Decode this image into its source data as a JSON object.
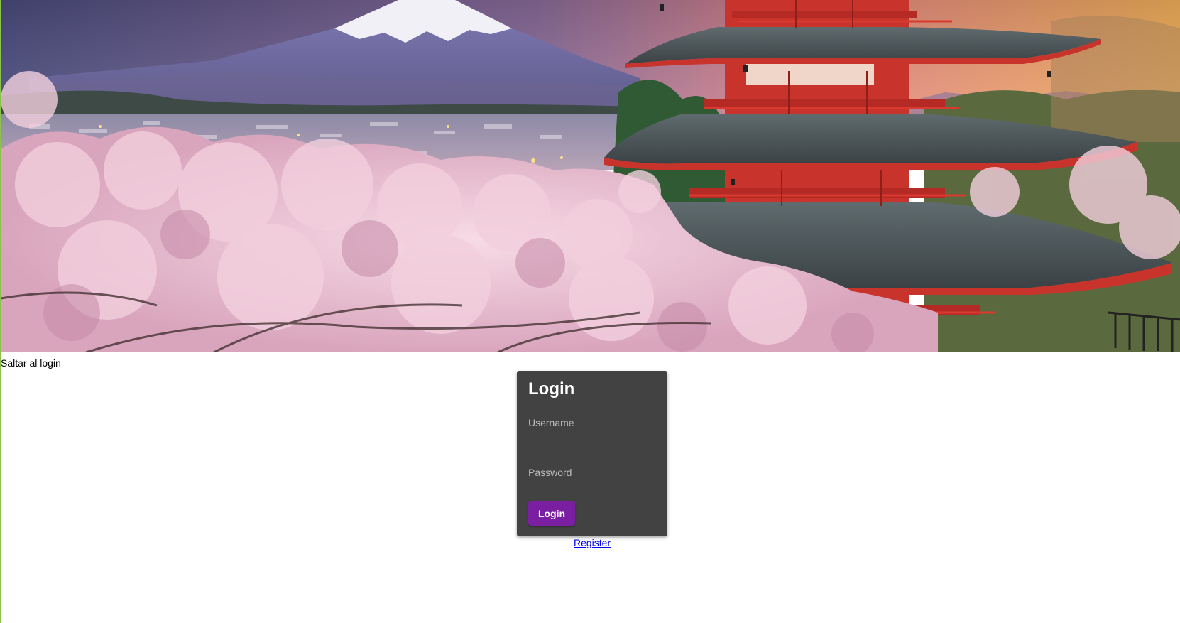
{
  "hero": {
    "image_alt": "Mount Fuji with cherry blossoms and red pagoda"
  },
  "skip_link": {
    "label": "Saltar al login"
  },
  "login": {
    "title": "Login",
    "username_placeholder": "Username",
    "password_placeholder": "Password",
    "button_label": "Login"
  },
  "register_link": {
    "label": "Register"
  },
  "colors": {
    "card_background": "#424242",
    "button_background": "#7b1fa2",
    "link": "#0000ee"
  }
}
